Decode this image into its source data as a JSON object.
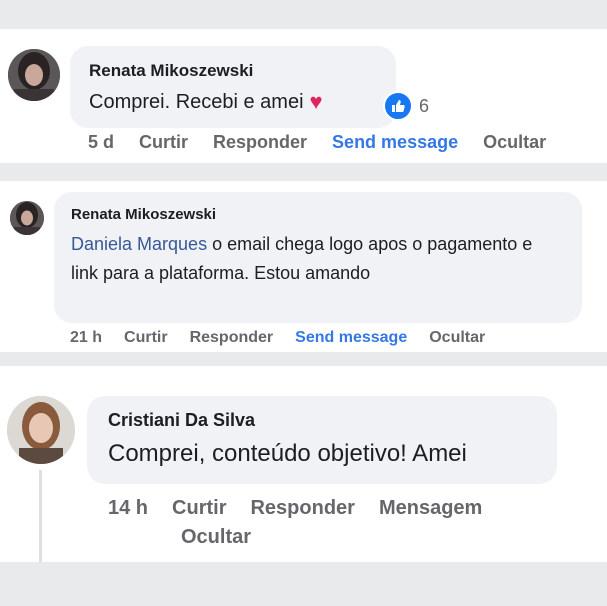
{
  "comments": [
    {
      "author": "Renata Mikoszewski",
      "text": "Comprei. Recebi e amei",
      "reaction_emoji": "♥",
      "like_count": "6",
      "actions": {
        "time": "5 d",
        "like": "Curtir",
        "reply": "Responder",
        "message": "Send message",
        "hide": "Ocultar"
      }
    },
    {
      "author": "Renata Mikoszewski",
      "mention": "Daniela Marques",
      "text": " o email chega logo apos o pagamento e link para a plataforma. Estou amando",
      "actions": {
        "time": "21 h",
        "like": "Curtir",
        "reply": "Responder",
        "message": "Send message",
        "hide": "Ocultar"
      }
    },
    {
      "author": "Cristiani Da Silva",
      "text": "Comprei, conteúdo objetivo! Amei",
      "actions": {
        "time": "14 h",
        "like": "Curtir",
        "reply": "Responder",
        "message": "Mensagem",
        "hide": "Ocultar"
      }
    }
  ],
  "colors": {
    "link_blue": "#3578e5",
    "like_blue": "#1877f2",
    "heart_red": "#e0245e",
    "bubble_gray": "#f0f2f5",
    "action_gray": "#65676b"
  },
  "icons": [
    "like-thumb-icon",
    "heart-icon",
    "avatar-photo"
  ]
}
